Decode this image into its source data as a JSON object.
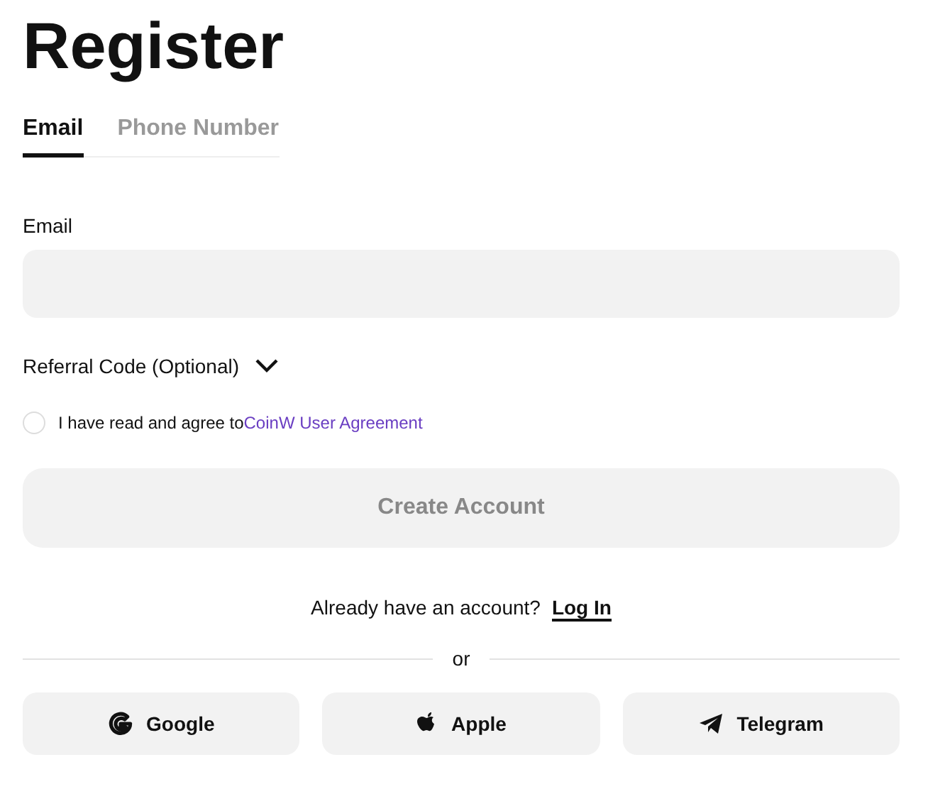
{
  "title": "Register",
  "tabs": [
    {
      "label": "Email",
      "selected": true
    },
    {
      "label": "Phone Number",
      "selected": false
    }
  ],
  "email": {
    "label": "Email"
  },
  "referral": {
    "label": "Referral Code (Optional)",
    "expanded": false
  },
  "agreement": {
    "text": "I have read and agree to",
    "link": "CoinW User Agreement",
    "checked": false
  },
  "create_button": {
    "label": "Create Account",
    "disabled": true
  },
  "login": {
    "prompt": "Already have an account?",
    "link": "Log In"
  },
  "divider": "or",
  "social": [
    {
      "kind": "google",
      "label": "Google"
    },
    {
      "kind": "apple",
      "label": "Apple"
    },
    {
      "kind": "telegram",
      "label": "Telegram"
    }
  ]
}
